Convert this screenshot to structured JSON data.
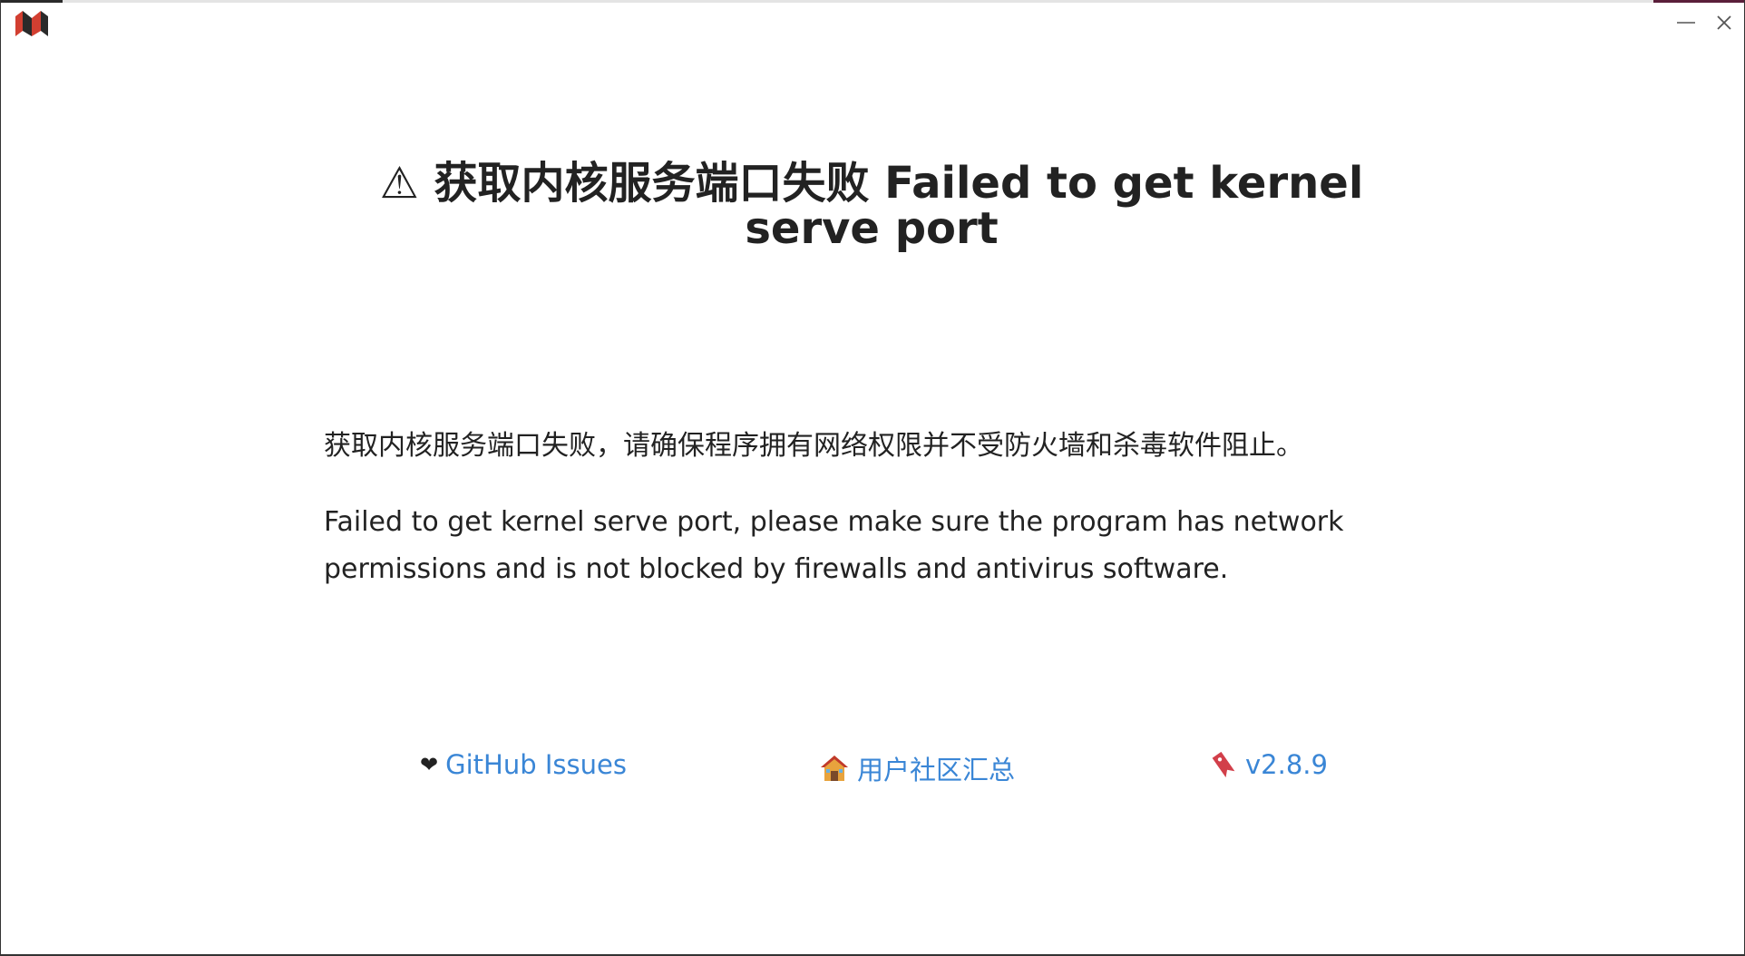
{
  "window": {
    "logo_icon": "siyuan-logo-icon",
    "minimize_icon": "minimize-icon",
    "close_icon": "close-icon"
  },
  "error": {
    "warning_symbol": "⚠",
    "title": "获取内核服务端口失败 Failed to get kernel serve port",
    "message_zh": "获取内核服务端口失败，请确保程序拥有网络权限并不受防火墙和杀毒软件阻止。",
    "message_en": "Failed to get kernel serve port, please make sure the program has network permissions and is not blocked by firewalls and antivirus software."
  },
  "links": {
    "github": {
      "emoji": "❤",
      "label": "GitHub Issues"
    },
    "community": {
      "emoji": "🏠",
      "label": "用户社区汇总"
    },
    "version": {
      "emoji": "🔖",
      "label": "v2.8.9"
    }
  },
  "colors": {
    "link": "#3a86d6",
    "text": "#222222",
    "logo_red": "#d23f31",
    "logo_dark": "#2a2a2a"
  }
}
